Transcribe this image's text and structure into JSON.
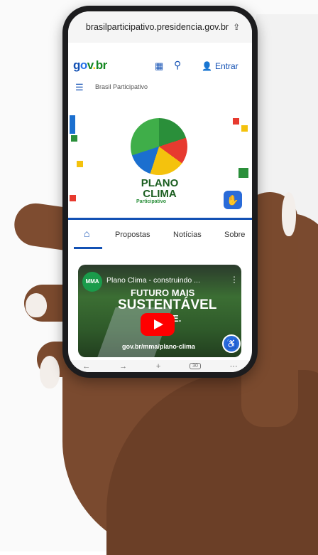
{
  "browser": {
    "url": "brasilparticipativo.presidencia.gov.br",
    "share_icon": "share-icon",
    "tab_count": "30"
  },
  "gov_header": {
    "logo_g": "g",
    "logo_o": "o",
    "logo_v": "v",
    "logo_dot": ".",
    "logo_br": "br",
    "login_label": "Entrar"
  },
  "menu": {
    "site_title": "Brasil Participativo"
  },
  "banner": {
    "plano": "PLANO",
    "clima": "CLIMA",
    "participativo": "Participativo"
  },
  "tabs": {
    "propostas": "Propostas",
    "noticias": "Notícias",
    "sobre": "Sobre"
  },
  "video": {
    "channel": "MMA",
    "title": "Plano Clima - construindo ...",
    "line1": "FUTURO MAIS",
    "line2": "SUSTENTÁVEL",
    "line3": "E ...TE.",
    "url_overlay": "gov.br/mma/plano-clima"
  },
  "colors": {
    "gov_blue": "#1351b4",
    "gov_green": "#168821",
    "youtube_red": "#ff0000",
    "skin": "#7a4a2f"
  }
}
